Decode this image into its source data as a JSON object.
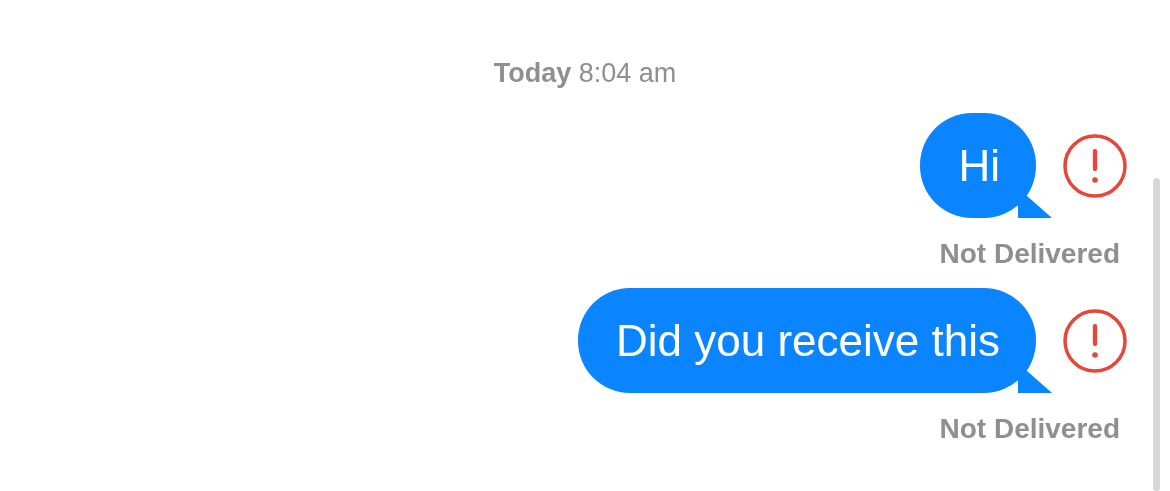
{
  "timestamp": {
    "day": "Today",
    "time": "8:04 am"
  },
  "messages": [
    {
      "text": "Hi",
      "failed": true,
      "status": "Not Delivered"
    },
    {
      "text": "Did you receive this",
      "failed": true,
      "status": "Not Delivered"
    }
  ]
}
